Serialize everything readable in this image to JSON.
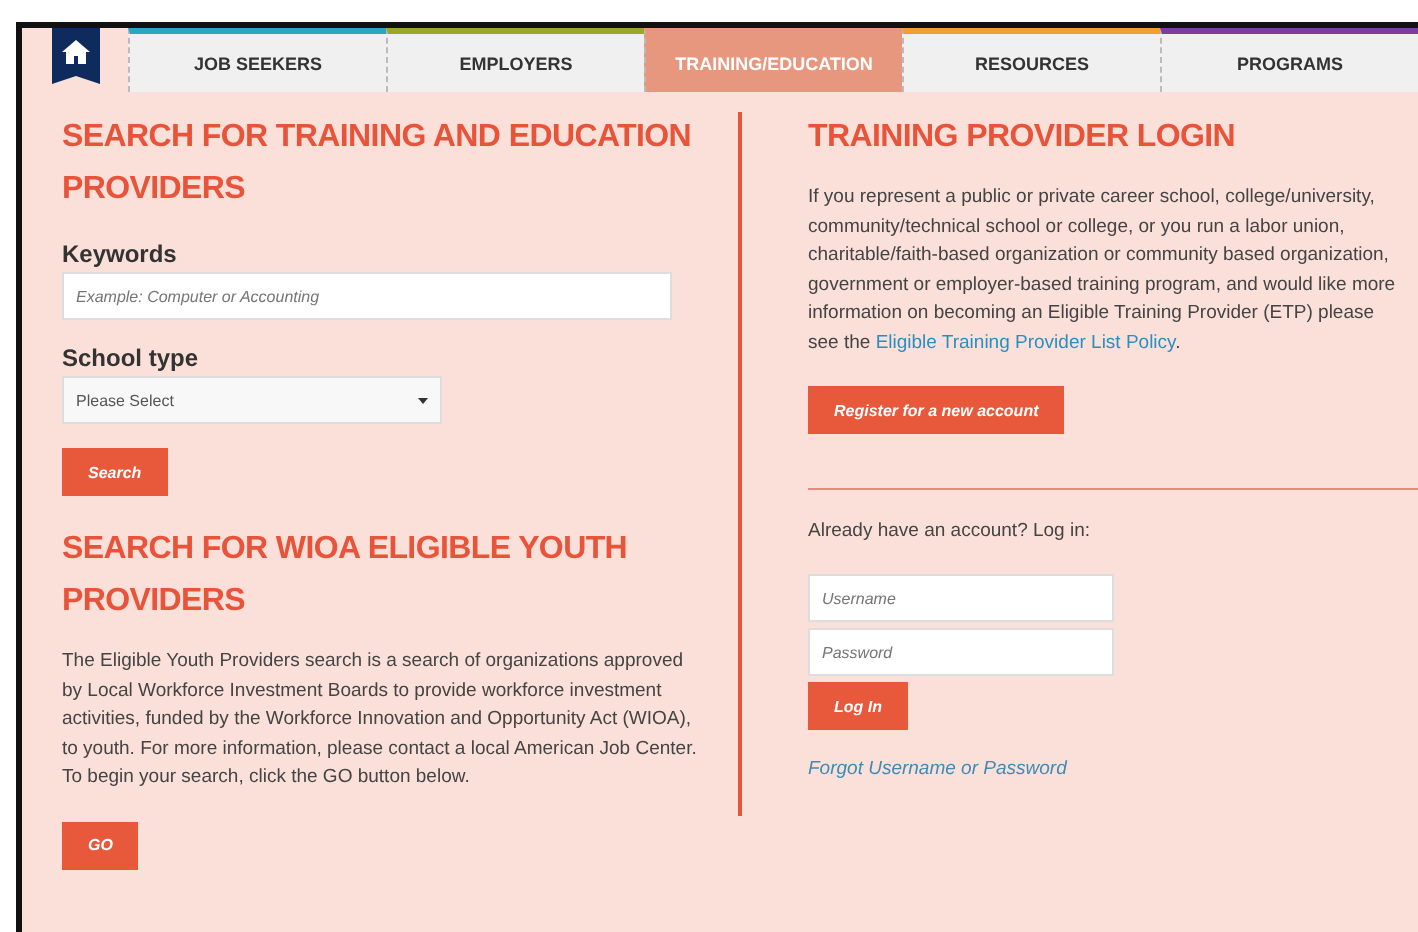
{
  "nav": {
    "home": true,
    "tabs": [
      {
        "label": "JOB SEEKERS",
        "selected": false,
        "color": "#2aa7c0"
      },
      {
        "label": "EMPLOYERS",
        "selected": false,
        "color": "#9aa82a"
      },
      {
        "label": "TRAINING/EDUCATION",
        "selected": true,
        "color": "#e8977f"
      },
      {
        "label": "RESOURCES",
        "selected": false,
        "color": "#f0a030"
      },
      {
        "label": "PROGRAMS",
        "selected": false,
        "color": "#7a3fa0"
      }
    ]
  },
  "training_search": {
    "title": "SEARCH FOR TRAINING AND EDUCATION PROVIDERS",
    "keywords_label": "Keywords",
    "keywords_placeholder": "Example: Computer or Accounting",
    "school_type_label": "School type",
    "school_type_value": "Please Select",
    "button": "Search"
  },
  "youth_search": {
    "title": "SEARCH FOR WIOA ELIGIBLE YOUTH PROVIDERS",
    "text": "The Eligible Youth Providers search is a search of organizations approved by Local Workforce Investment Boards to provide workforce investment activities, funded by the Workforce Innovation and Opportunity Act (WIOA), to youth. For more information, please contact a local American Job Center. To begin your search, click the GO button below.",
    "button": "GO"
  },
  "login": {
    "title": "TRAINING PROVIDER LOGIN",
    "text": "If you represent a public or private career school, college/university, community/technical school or college, or you run a labor union, charitable/faith-based organization or community based organization, government or employer-based training program, and would like more information on becoming an Eligible Training Provider (ETP) please see the",
    "link": "Eligible Training Provider List Policy",
    "link_after": ".",
    "register_button": "Register for a new account",
    "prompt": "Already have an account? Log in:",
    "username_placeholder": "Username",
    "password_placeholder": "Password",
    "login_button": "Log In",
    "forgot_link": "Forgot Username or Password"
  }
}
